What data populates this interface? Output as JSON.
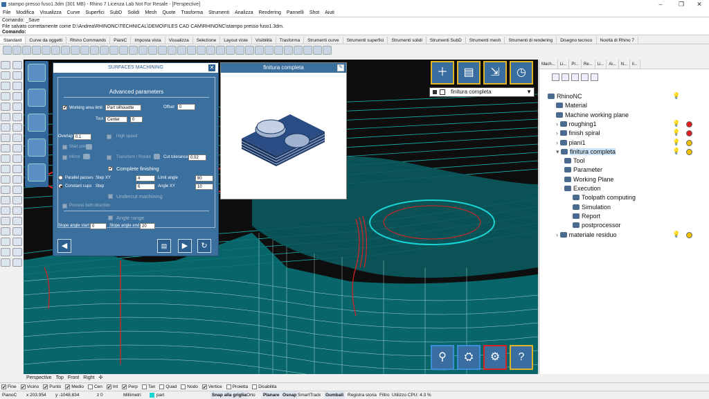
{
  "window": {
    "title": "stampo presso fuso1.3dm (301 MB) - Rhino 7 Licenza Lab Not For Resale - [Perspective]"
  },
  "menu": [
    "File",
    "Modifica",
    "Visualizza",
    "Curve",
    "Superfici",
    "SubD",
    "Solidi",
    "Mesh",
    "Quote",
    "Trasforma",
    "Strumenti",
    "Analizza",
    "Rendering",
    "Pannelli",
    "Shot",
    "Aiuti"
  ],
  "command_history": [
    "Comando: _Save",
    "File salvato correttamente come D:\\Andrea\\RHINONC\\TECHNICAL\\DEMO\\FILES CAD CAM\\RHINONC\\stampo presso fuso1.3dm.",
    "Comando:"
  ],
  "toolbar_tabs": [
    "Standard",
    "Curve da oggetti",
    "Rhino Commands",
    "PianiC",
    "Imposta vista",
    "Visualizza",
    "Selezione",
    "Layout viste",
    "Visibilità",
    "Trasforma",
    "Strumenti curve",
    "Strumenti superfici",
    "Strumenti solidi",
    "Strumenti SubD",
    "Strumenti mesh",
    "Strumenti di rendering",
    "Disegno tecnico",
    "Novità di Rhino 7"
  ],
  "panel": {
    "title": "SURFACES MACHINING",
    "section": "Advanced parameters",
    "working_area_limit": "Working area limit",
    "working_area_select": "Part silhouette",
    "offset_label": "Offset",
    "offset_value": "0",
    "tool_label": "Tool",
    "tool_select": "Center",
    "tool_value": "0",
    "overlap_label": "Overlap",
    "overlap_value": "0.1",
    "high_speed": "High speed",
    "start_point": "Start point",
    "mirror": "Mirror",
    "transform_rotate": "Transform / Rotate",
    "cut_tolerance_label": "Cut tolerance",
    "cut_tolerance_value": "0.02",
    "complete_finishing": "Complete finishing",
    "parallel_passes": "Parallel passes",
    "constant_cups": "Constant cups",
    "step_xy_label": "Step XY",
    "step_xy_value": "4",
    "step_label": "Step",
    "step_value": "6",
    "limit_angle_label": "Limit angle",
    "limit_angle_value": "80",
    "angle_xy_label": "Angle XY",
    "angle_xy_value": "10",
    "undercut": "Undercut machining",
    "process_both": "Process both direction",
    "angle_range": "Angle range",
    "slope_start_label": "Slope angle start",
    "slope_start_value": "0",
    "slope_end_label": "Slope angle end",
    "slope_end_value": "20"
  },
  "preview_title": "finitura completa",
  "operation_select": "finitura completa",
  "right_tabs": [
    "Mach...",
    "Li...",
    "Pr...",
    "Re...",
    "Li...",
    "Ai...",
    "N...",
    "li..."
  ],
  "tree": [
    {
      "label": "RhinoNC",
      "level": 0
    },
    {
      "label": "Material",
      "level": 1
    },
    {
      "label": "Machine working plane",
      "level": 1
    },
    {
      "label": "roughing1",
      "level": 1
    },
    {
      "label": "finish spiral",
      "level": 1
    },
    {
      "label": "piani1",
      "level": 1
    },
    {
      "label": "finitura completa",
      "level": 1
    },
    {
      "label": "Tool",
      "level": 2
    },
    {
      "label": "Parameter",
      "level": 2
    },
    {
      "label": "Working Plane",
      "level": 2
    },
    {
      "label": "Execution",
      "level": 2
    },
    {
      "label": "Toolpath computing",
      "level": 3
    },
    {
      "label": "Simulation",
      "level": 3
    },
    {
      "label": "Report",
      "level": 3
    },
    {
      "label": "postprocessor",
      "level": 3
    },
    {
      "label": "materiale residuo",
      "level": 1
    }
  ],
  "viewport_tabs": [
    "Perspective",
    "Top",
    "Front",
    "Right"
  ],
  "osnaps": [
    {
      "label": "Fine",
      "on": true
    },
    {
      "label": "Vicino",
      "on": true
    },
    {
      "label": "Punto",
      "on": true
    },
    {
      "label": "Medio",
      "on": true
    },
    {
      "label": "Cen",
      "on": false
    },
    {
      "label": "Int",
      "on": true
    },
    {
      "label": "Perp",
      "on": true
    },
    {
      "label": "Tan",
      "on": false
    },
    {
      "label": "Quad",
      "on": false
    },
    {
      "label": "Nodo",
      "on": false
    },
    {
      "label": "Vertice",
      "on": true
    },
    {
      "label": "Proietta",
      "on": false
    },
    {
      "label": "Disabilita",
      "on": false
    }
  ],
  "status": {
    "plane": "PianoC",
    "x": "x 203.954",
    "y": "y -1048.834",
    "z": "z 0",
    "units": "Millimetri",
    "layer": "part",
    "snap": "Snap alla griglia",
    "orto": "Orto",
    "planare": "Planare",
    "osnap": "Osnap",
    "smarttrack": "SmartTrack",
    "gumball": "Gumball",
    "registra": "Registra storia",
    "filtro": "Filtro",
    "cpu": "Utilizzo CPU: 4.3 %"
  },
  "colors": {
    "panel_blue": "#3a6f9e",
    "accent_yellow": "#e2b227",
    "cyan": "#19d4d4",
    "toolpath_red": "#e02020"
  }
}
